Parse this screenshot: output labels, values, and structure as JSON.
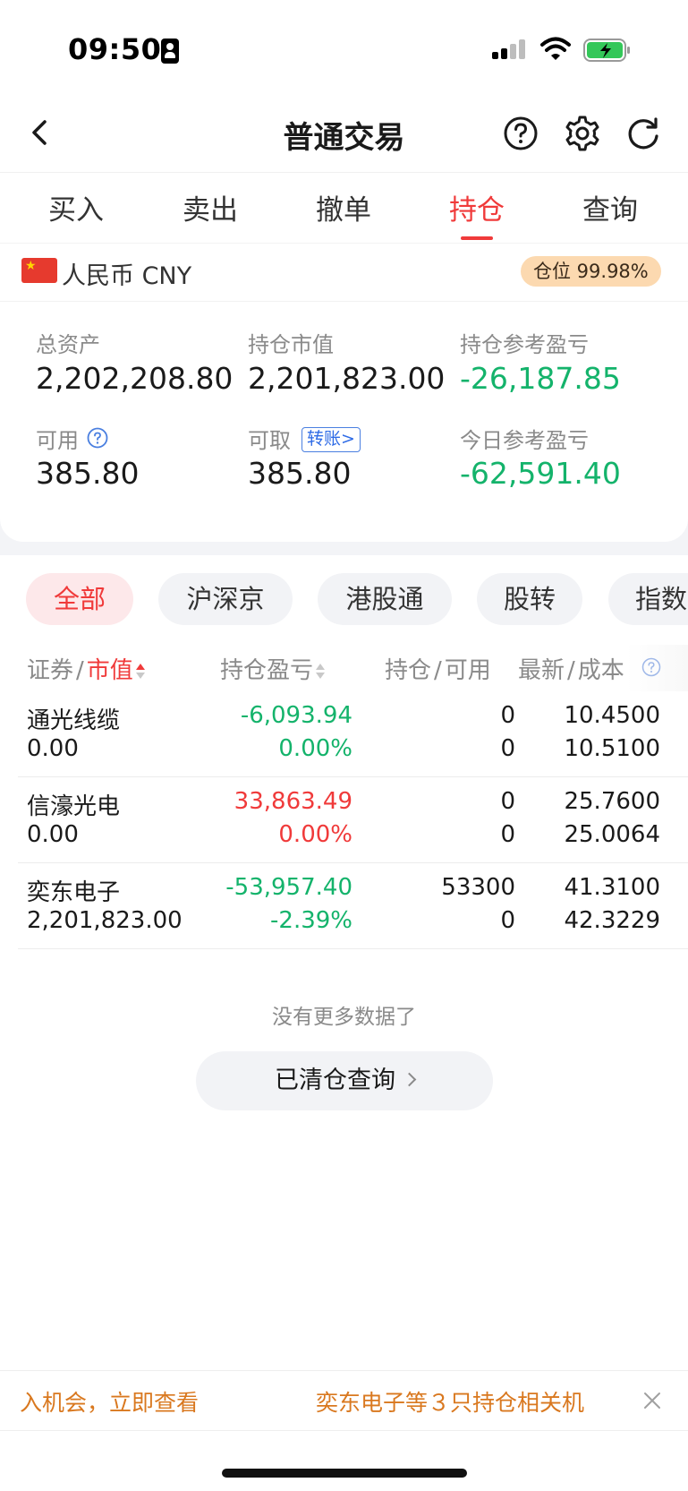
{
  "status_bar": {
    "time": "09:50"
  },
  "nav": {
    "title": "普通交易"
  },
  "tabs": [
    {
      "label": "买入"
    },
    {
      "label": "卖出"
    },
    {
      "label": "撤单"
    },
    {
      "label": "持仓",
      "active": true
    },
    {
      "label": "查询"
    }
  ],
  "account": {
    "currency_label": "人民币 CNY",
    "position_ratio": "仓位 99.98%",
    "total_assets_label": "总资产",
    "total_assets": "2,202,208.80",
    "market_value_label": "持仓市值",
    "market_value": "2,201,823.00",
    "holding_pl_label": "持仓参考盈亏",
    "holding_pl": "-26,187.85",
    "available_label": "可用",
    "available": "385.80",
    "withdrawable_label": "可取",
    "transfer_label": "转账>",
    "withdrawable": "385.80",
    "today_pl_label": "今日参考盈亏",
    "today_pl": "-62,591.40"
  },
  "filters": [
    {
      "label": "全部",
      "active": true
    },
    {
      "label": "沪深京"
    },
    {
      "label": "港股通"
    },
    {
      "label": "股转"
    },
    {
      "label": "指数"
    }
  ],
  "table": {
    "headers": {
      "security": "证券",
      "market_value": "市值",
      "pl": "持仓盈亏",
      "holding": "持仓",
      "available": "可用",
      "latest": "最新",
      "cost": "成本",
      "sep": "/"
    },
    "rows": [
      {
        "name": "通光线缆",
        "market_value": "0.00",
        "pl": "-6,093.94",
        "pl_pct": "0.00%",
        "holding": "0",
        "available": "0",
        "latest": "10.4500",
        "cost": "10.5100",
        "pl_sign": "neg"
      },
      {
        "name": "信濠光电",
        "market_value": "0.00",
        "pl": "33,863.49",
        "pl_pct": "0.00%",
        "holding": "0",
        "available": "0",
        "latest": "25.7600",
        "cost": "25.0064",
        "pl_sign": "pos"
      },
      {
        "name": "奕东电子",
        "market_value": "2,201,823.00",
        "pl": "-53,957.40",
        "pl_pct": "-2.39%",
        "holding": "53300",
        "available": "0",
        "latest": "41.3100",
        "cost": "42.3229",
        "pl_sign": "neg"
      }
    ]
  },
  "footer": {
    "no_more": "没有更多数据了",
    "cleared_query": "已清仓查询"
  },
  "ticker": {
    "text_a": "入机会，立即查看",
    "text_b": "奕东电子等３只持仓相关机"
  },
  "colors": {
    "accent_red": "#f03a3a",
    "gain_green": "#14b36b",
    "badge_bg": "#fcd9b0",
    "ticker_orange": "#d9781f"
  }
}
